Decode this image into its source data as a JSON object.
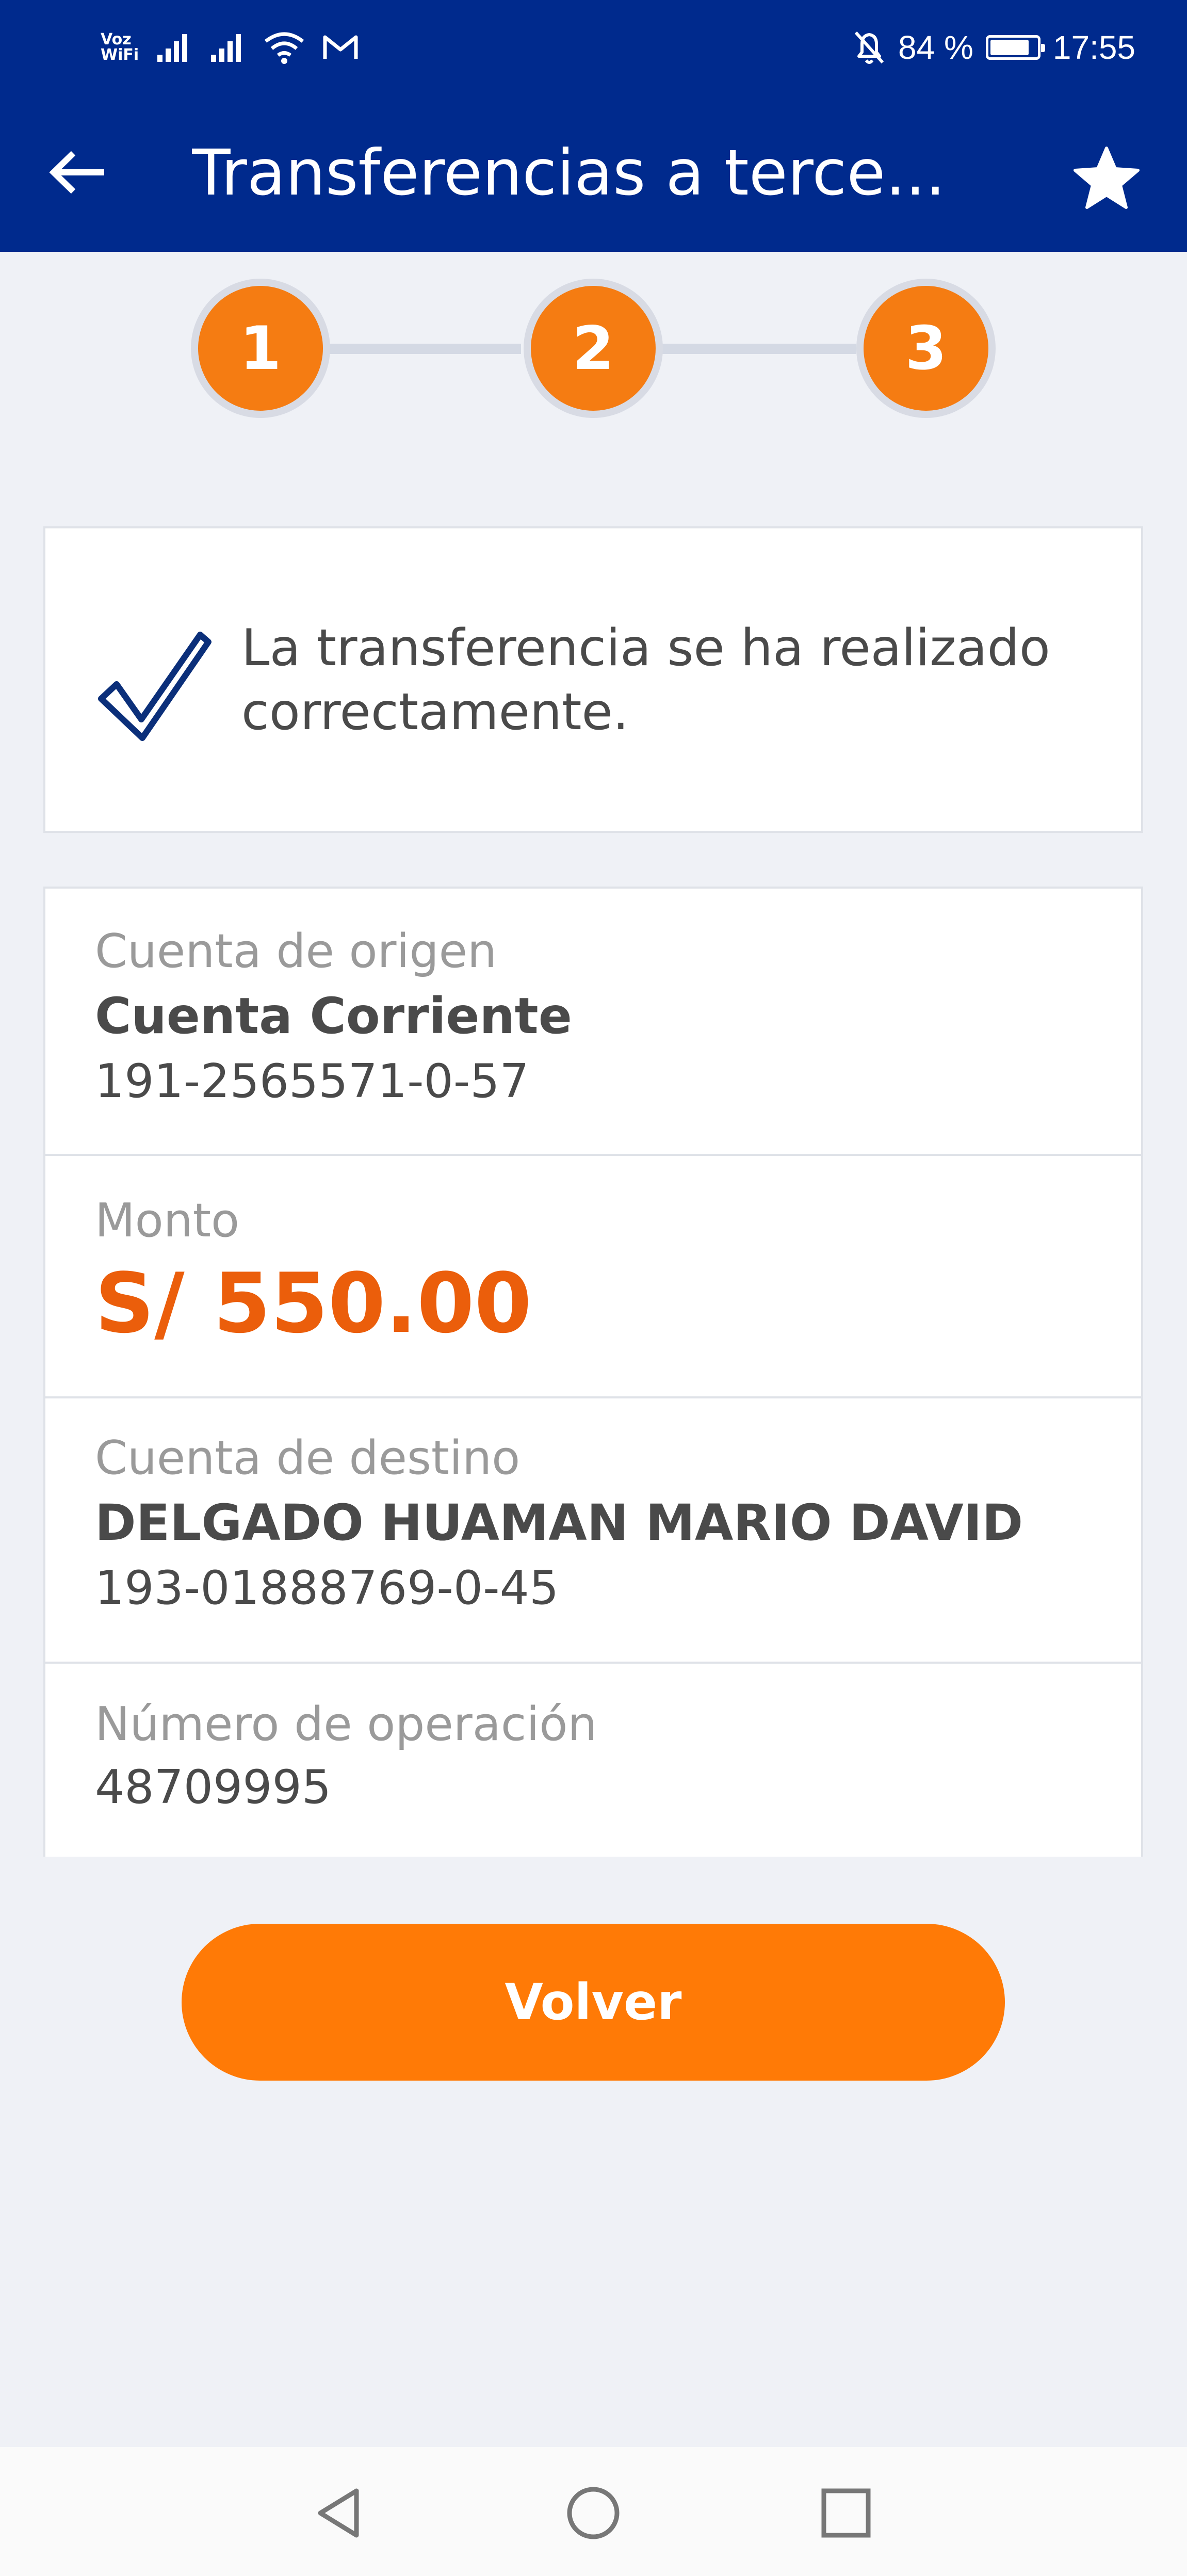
{
  "status_bar": {
    "voz_label_top": "Voz",
    "voz_label_bottom": "WiFi",
    "battery_text": "84 %",
    "battery_level": 0.84,
    "time": "17:55",
    "icons": [
      "signal-icon",
      "signal-icon",
      "wifi-icon",
      "gmail-icon",
      "bell-off-icon",
      "battery-icon"
    ]
  },
  "app_bar": {
    "title": "Transferencias a terce...",
    "back_icon": "arrow-left-icon",
    "favorite_icon": "star-icon"
  },
  "stepper": {
    "steps": [
      "1",
      "2",
      "3"
    ],
    "current_step": 3
  },
  "success": {
    "message": "La transferencia se ha realizado correctamente.",
    "icon": "check-icon"
  },
  "details": {
    "origin": {
      "label": "Cuenta de origen",
      "name": "Cuenta Corriente",
      "number": "191-2565571-0-57"
    },
    "amount": {
      "label": "Monto",
      "value": "S/ 550.00"
    },
    "destination": {
      "label": "Cuenta de destino",
      "name": "DELGADO HUAMAN MARIO DAVID",
      "number": "193-01888769-0-45"
    },
    "operation": {
      "label": "Número de operación",
      "number": "48709995"
    }
  },
  "actions": {
    "back_label": "Volver"
  },
  "nav_bar": {
    "icons": [
      "back-triangle-icon",
      "home-circle-icon",
      "recents-square-icon"
    ]
  },
  "colors": {
    "header": "#002a8d",
    "accent": "#ff7a06",
    "amount": "#eb5e0b",
    "check": "#0b2f7a",
    "background": "#eff1f6"
  }
}
